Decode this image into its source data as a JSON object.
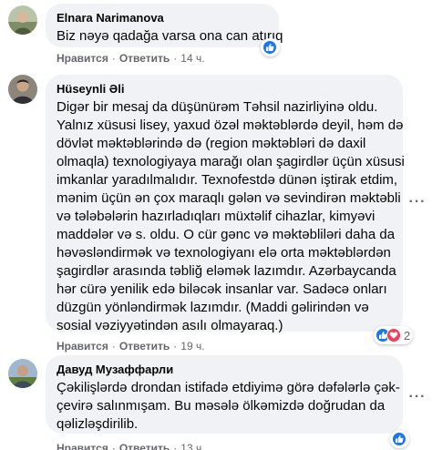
{
  "comments": [
    {
      "author": "Elnara Narimanova",
      "lines": [
        "Biz nəyə qadağa varsa ona can atırıq"
      ],
      "like_label": "Нравится",
      "reply_label": "Ответить",
      "time": "14 ч.",
      "reactions": [
        "like"
      ],
      "reaction_count": ""
    },
    {
      "author": "Hüseynli Əli",
      "lines": [
        "Digər bir mesaj da düşünürəm Təhsil nazirliyinə oldu.",
        "Yalnız xüsusi lisey, yaxud özəl məktəblərdə deyil, həm də",
        "dövlət məktəblərində də (region məktəbləri də daxil",
        "olmaqla) texnologiyaya marağı olan şagirdlər üçün xüsusi",
        "imkanlar yaradılmalıdır. Texnofestdə dünən iştirak etdim,",
        "mənim üçün ən çox maraqlı gələn və sevindirən məktəbli",
        "və tələbələrin hazırladıqları müxtəlif cihazlar, kimyəvi",
        "maddələr və s. oldu. O cür gənc və məktəbliləri daha da",
        "həvəsləndirmək və texnologiyanı elə orta məktəblərdən",
        "şagirdlər arasında təbliğ eləmək lazımdır. Azərbaycanda",
        "hər cürə yenilik edə biləcək insanlar var. Sadəcə onları",
        "düzgün yönləndirmək lazımdır. (Maddi gəlirindən və",
        "sosial vəziyyətindən asılı olmayaraq.)"
      ],
      "like_label": "Нравится",
      "reply_label": "Ответить",
      "time": "19 ч.",
      "reactions": [
        "like",
        "heart"
      ],
      "reaction_count": "2"
    },
    {
      "author": "Давуд Музаффарли",
      "lines": [
        "Çəkilişlərdə drondan istifadə etdiyimə görə dəfələrlə çək-",
        "çevirə salınmışam. Bu məsələ ölkəmizdə doğrudan da",
        "qəlizləşdirilib."
      ],
      "like_label": "Нравится",
      "reply_label": "Ответить",
      "time": "13 ч.",
      "reactions": [
        "like"
      ],
      "reaction_count": ""
    }
  ],
  "icons": {
    "like": "thumbs-up-icon",
    "heart": "heart-icon",
    "more": "more-options-icon"
  },
  "colors": {
    "bubble": "#f0f2f5",
    "like": "#1877f2",
    "heart": "#f33e58",
    "meta": "#65676b"
  }
}
